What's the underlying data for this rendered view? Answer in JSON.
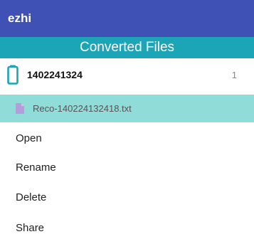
{
  "app_bar": {
    "title": "ezhi",
    "color": "#3f51b5"
  },
  "section_header": {
    "title": "Converted Files",
    "color": "#1ca5b6"
  },
  "folder": {
    "icon": "phone-icon",
    "name": "1402241324",
    "count": "1"
  },
  "file": {
    "icon": "document-icon",
    "name": "Reco-140224132418.txt",
    "highlight_color": "#8fdcd8"
  },
  "context_menu": {
    "items": [
      {
        "label": "Open"
      },
      {
        "label": "Rename"
      },
      {
        "label": "Delete"
      },
      {
        "label": "Share"
      }
    ]
  }
}
